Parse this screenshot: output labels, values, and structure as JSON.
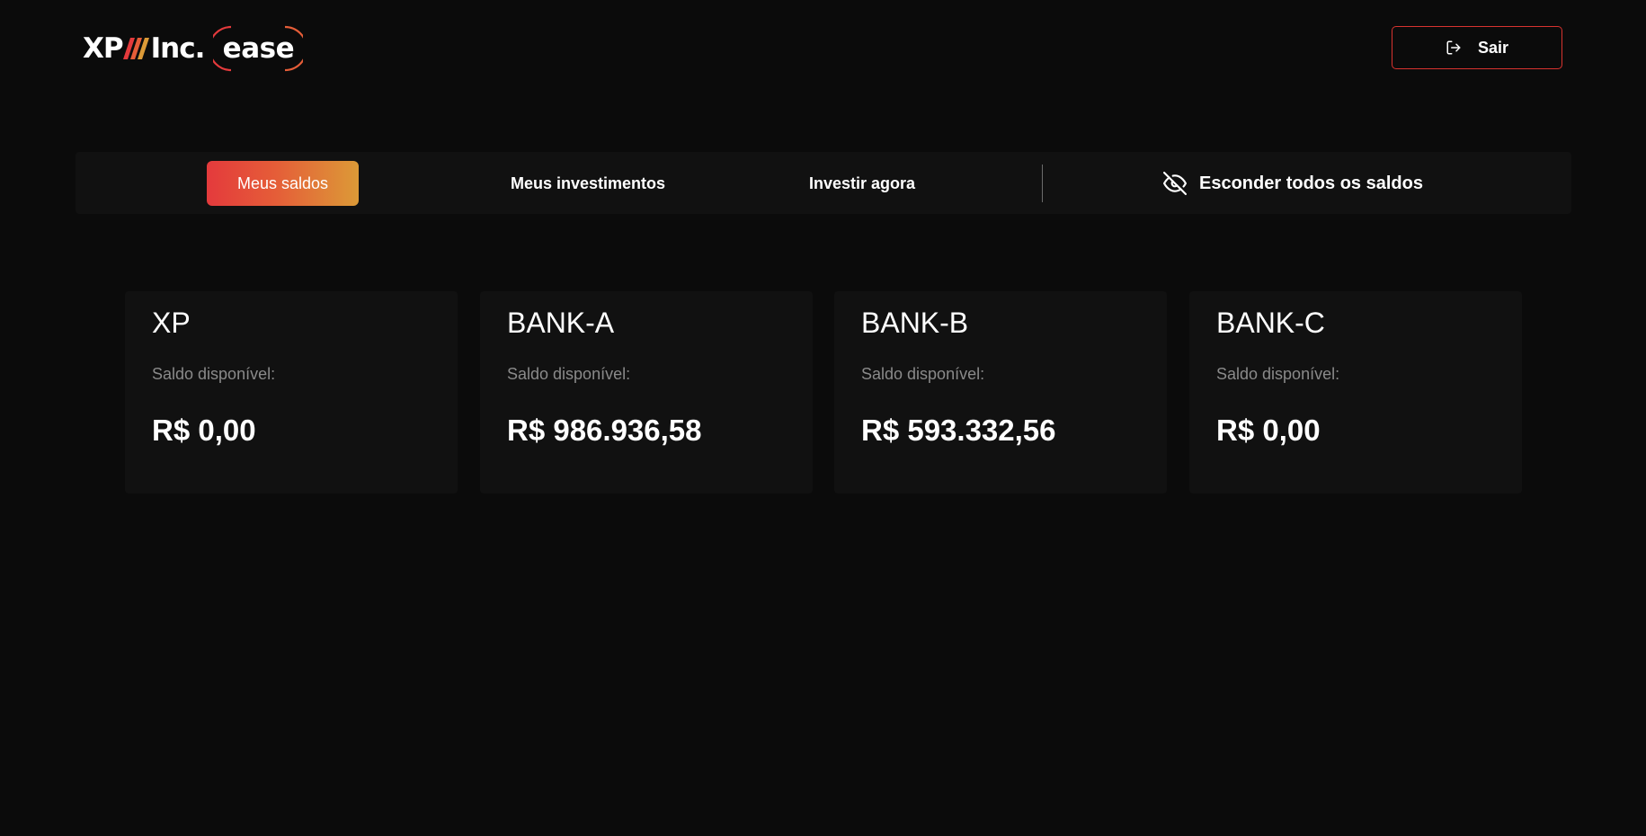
{
  "brand": {
    "logo_xp": "XP",
    "logo_inc": "Inc.",
    "logo_ease": "ease",
    "accent_color": "#d8332f",
    "gradient_start": "#e43a3c",
    "gradient_end": "#dc9a37"
  },
  "header": {
    "logout_label": "Sair",
    "logout_icon": "logout-icon"
  },
  "nav": {
    "tabs": [
      {
        "label": "Meus saldos",
        "active": true
      },
      {
        "label": "Meus investimentos",
        "active": false
      },
      {
        "label": "Investir agora",
        "active": false
      }
    ],
    "hide_balances_label": "Esconder todos os saldos",
    "hide_balances_icon": "eye-off-icon"
  },
  "accounts": [
    {
      "name": "XP",
      "label": "Saldo disponível:",
      "balance": "R$ 0,00"
    },
    {
      "name": "BANK-A",
      "label": "Saldo disponível:",
      "balance": "R$ 986.936,58"
    },
    {
      "name": "BANK-B",
      "label": "Saldo disponível:",
      "balance": "R$ 593.332,56"
    },
    {
      "name": "BANK-C",
      "label": "Saldo disponível:",
      "balance": "R$ 0,00"
    }
  ]
}
